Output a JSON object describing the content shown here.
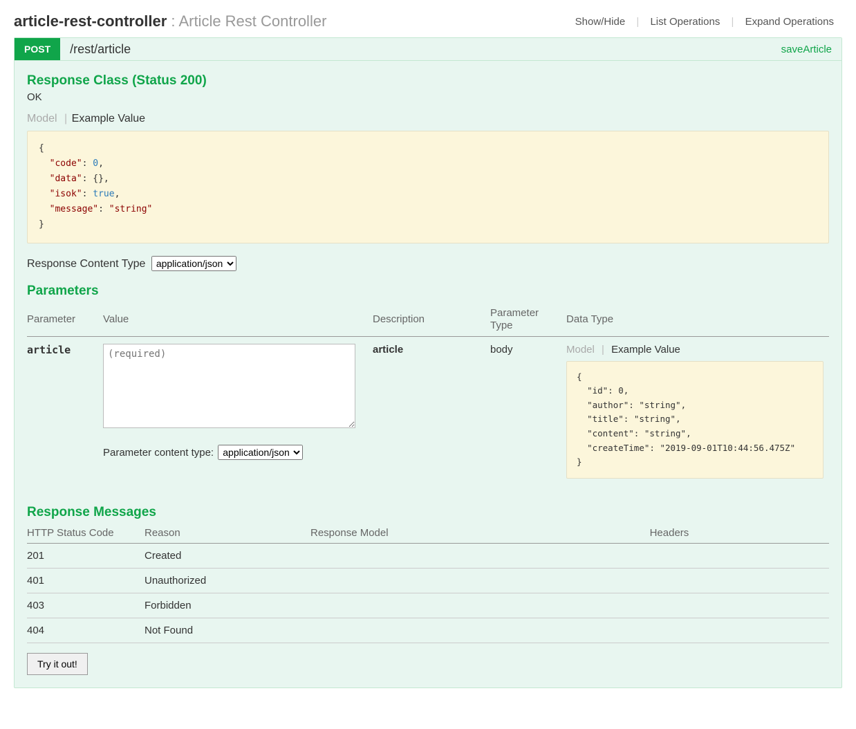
{
  "header": {
    "controller_name": "article-rest-controller",
    "controller_desc": "Article Rest Controller",
    "links": {
      "show_hide": "Show/Hide",
      "list_ops": "List Operations",
      "expand_ops": "Expand Operations"
    }
  },
  "operation": {
    "method": "POST",
    "path": "/rest/article",
    "name": "saveArticle"
  },
  "response_class": {
    "title": "Response Class (Status 200)",
    "status_text": "OK",
    "tabs": {
      "model": "Model",
      "example": "Example Value"
    },
    "example_json": "{\n  \"code\": 0,\n  \"data\": {},\n  \"isok\": true,\n  \"message\": \"string\"\n}"
  },
  "response_content_type": {
    "label": "Response Content Type",
    "options": [
      "application/json"
    ],
    "selected": "application/json"
  },
  "parameters": {
    "title": "Parameters",
    "headers": {
      "parameter": "Parameter",
      "value": "Value",
      "description": "Description",
      "ptype": "Parameter Type",
      "dtype": "Data Type"
    },
    "row": {
      "name": "article",
      "placeholder": "(required)",
      "description": "article",
      "ptype": "body",
      "content_type_label": "Parameter content type:",
      "content_type_options": [
        "application/json"
      ],
      "content_type_selected": "application/json",
      "datatype_tabs": {
        "model": "Model",
        "example": "Example Value"
      },
      "datatype_example": "{\n  \"id\": 0,\n  \"author\": \"string\",\n  \"title\": \"string\",\n  \"content\": \"string\",\n  \"createTime\": \"2019-09-01T10:44:56.475Z\"\n}"
    }
  },
  "response_messages": {
    "title": "Response Messages",
    "headers": {
      "code": "HTTP Status Code",
      "reason": "Reason",
      "model": "Response Model",
      "headers": "Headers"
    },
    "rows": [
      {
        "code": "201",
        "reason": "Created"
      },
      {
        "code": "401",
        "reason": "Unauthorized"
      },
      {
        "code": "403",
        "reason": "Forbidden"
      },
      {
        "code": "404",
        "reason": "Not Found"
      }
    ]
  },
  "try_button": "Try it out!"
}
